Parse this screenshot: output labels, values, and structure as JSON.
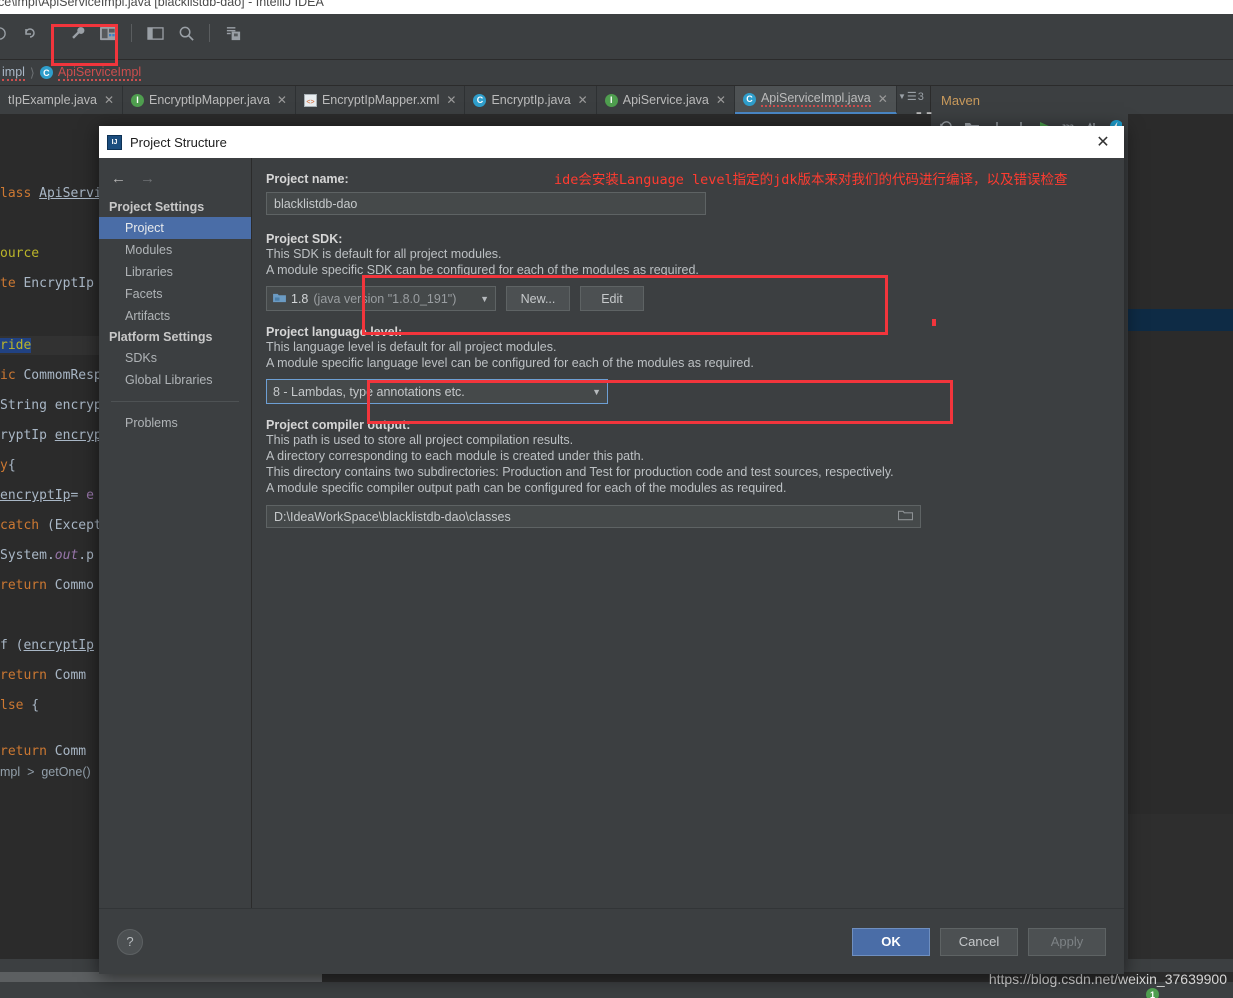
{
  "ide": {
    "window_title": "ce\\impl\\ApiServiceImpl.java [blacklistdb-dao] - IntelliJ IDEA",
    "toolbar_icons": [
      "run-icon",
      "undo-icon",
      "wrench-icon",
      "project-structure-icon",
      "layout-icon",
      "search-icon",
      "save-all-icon"
    ],
    "breadcrumb": {
      "package": "impl",
      "class_badge": "C",
      "class": "ApiServiceImpl"
    },
    "tabs": [
      {
        "label": "tIpExample.java",
        "icon": "none",
        "active": false
      },
      {
        "label": "EncryptIpMapper.java",
        "icon": "interface-icon",
        "active": false
      },
      {
        "label": "EncryptIpMapper.xml",
        "icon": "xml-icon",
        "active": false
      },
      {
        "label": "EncryptIp.java",
        "icon": "class-icon",
        "active": false
      },
      {
        "label": "ApiService.java",
        "icon": "interface-icon",
        "active": false
      },
      {
        "label": "ApiServiceImpl.java",
        "icon": "class-icon",
        "active": true
      }
    ],
    "tab_overflow_count": "3",
    "maven": {
      "title": "Maven"
    },
    "status_url": "https://blog.csdn.net/weixin_37639900",
    "status_badge": "1",
    "code_lines": [
      "lass ApiServi",
      "ource",
      "te EncryptIp",
      "ride",
      "ic CommomResp",
      "String encryp",
      "ryptIp encryp",
      "y{",
      "encryptIp= e",
      "catch (Except",
      "System.out.p",
      "return Commo",
      "f (encryptIp",
      "return Comm",
      "lse {",
      "return Comm"
    ],
    "editor_footer_breadcrumb": "mpl  >  getOne()"
  },
  "dialog": {
    "title": "Project Structure",
    "close_label": "✕",
    "nav": {
      "back": "←",
      "forward": "→"
    },
    "sidebar": {
      "group_project": "Project Settings",
      "project_items": [
        "Project",
        "Modules",
        "Libraries",
        "Facets",
        "Artifacts"
      ],
      "selected_item": "Project",
      "group_platform": "Platform Settings",
      "platform_items": [
        "SDKs",
        "Global Libraries"
      ],
      "problems_item": "Problems"
    },
    "project_name": {
      "label": "Project name:",
      "value": "blacklistdb-dao"
    },
    "project_sdk": {
      "label": "Project SDK:",
      "desc1": "This SDK is default for all project modules.",
      "desc2": "A module specific SDK can be configured for each of the modules as required.",
      "value": "1.8",
      "value_detail": "(java version \"1.8.0_191\")",
      "new_button": "New...",
      "edit_button": "Edit"
    },
    "project_language_level": {
      "label": "Project language level:",
      "desc1": "This language level is default for all project modules.",
      "desc2": "A module specific language level can be configured for each of the modules as required.",
      "value": "8 - Lambdas, type annotations etc."
    },
    "project_compiler_output": {
      "label": "Project compiler output:",
      "desc1": "This path is used to store all project compilation results.",
      "desc2": "A directory corresponding to each module is created under this path.",
      "desc3": "This directory contains two subdirectories: Production and Test for production code and test sources, respectively.",
      "desc4": "A module specific compiler output path can be configured for each of the modules as required.",
      "value": "D:\\IdeaWorkSpace\\blacklistdb-dao\\classes"
    },
    "annotation_note": "ide会安装Language level指定的jdk版本来对我们的代码进行编译，以及错误检查",
    "footer": {
      "help": "?",
      "ok": "OK",
      "cancel": "Cancel",
      "apply": "Apply"
    }
  },
  "colors": {
    "accent_blue": "#4a6da7",
    "highlight_red": "#f2353c",
    "panel_bg": "#3c3f41",
    "editor_bg": "#2b2b2b",
    "note_red": "#ff3b30"
  }
}
